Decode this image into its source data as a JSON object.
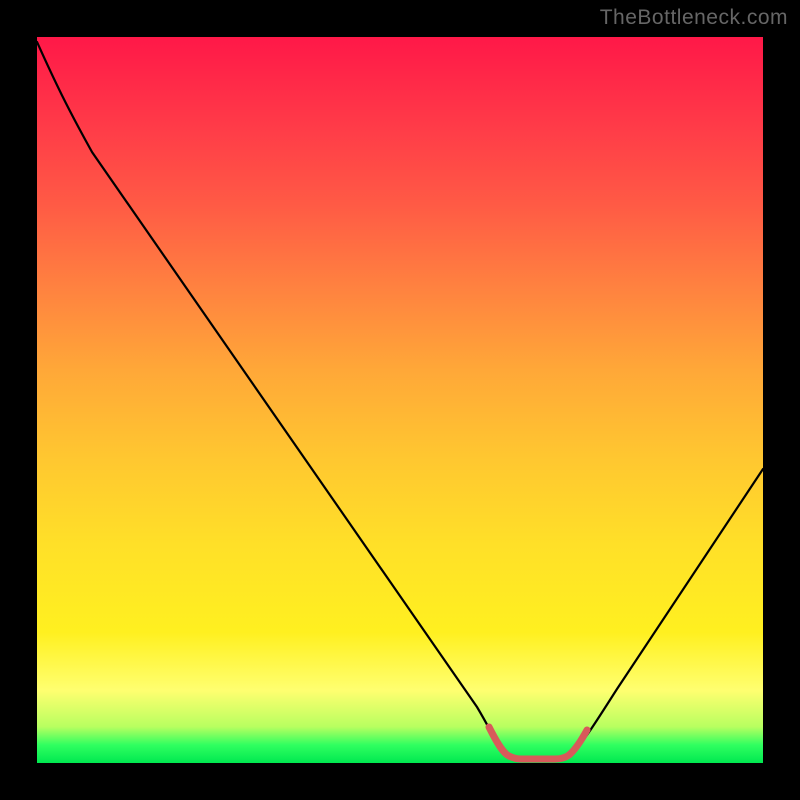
{
  "watermark": "TheBottleneck.com",
  "chart_data": {
    "type": "line",
    "title": "",
    "xlabel": "",
    "ylabel": "",
    "xlim": [
      0,
      100
    ],
    "ylim": [
      0,
      100
    ],
    "series": [
      {
        "name": "curve",
        "color": "#000000",
        "points": [
          {
            "x": 0,
            "y": 99
          },
          {
            "x": 4,
            "y": 93
          },
          {
            "x": 10,
            "y": 83
          },
          {
            "x": 20,
            "y": 68
          },
          {
            "x": 30,
            "y": 53
          },
          {
            "x": 40,
            "y": 38
          },
          {
            "x": 50,
            "y": 22
          },
          {
            "x": 58,
            "y": 8
          },
          {
            "x": 62,
            "y": 2
          },
          {
            "x": 64,
            "y": 0.5
          },
          {
            "x": 72,
            "y": 0.5
          },
          {
            "x": 74,
            "y": 1.5
          },
          {
            "x": 78,
            "y": 5
          },
          {
            "x": 85,
            "y": 17
          },
          {
            "x": 92,
            "y": 28
          },
          {
            "x": 100,
            "y": 41
          }
        ]
      },
      {
        "name": "highlight",
        "color": "#d85a5a",
        "points": [
          {
            "x": 62,
            "y": 2
          },
          {
            "x": 64,
            "y": 0.5
          },
          {
            "x": 72,
            "y": 0.5
          },
          {
            "x": 74,
            "y": 1.5
          }
        ]
      }
    ],
    "gradient_colors": {
      "top": "#ff1848",
      "mid": "#ffe028",
      "bottom": "#00e850"
    }
  }
}
